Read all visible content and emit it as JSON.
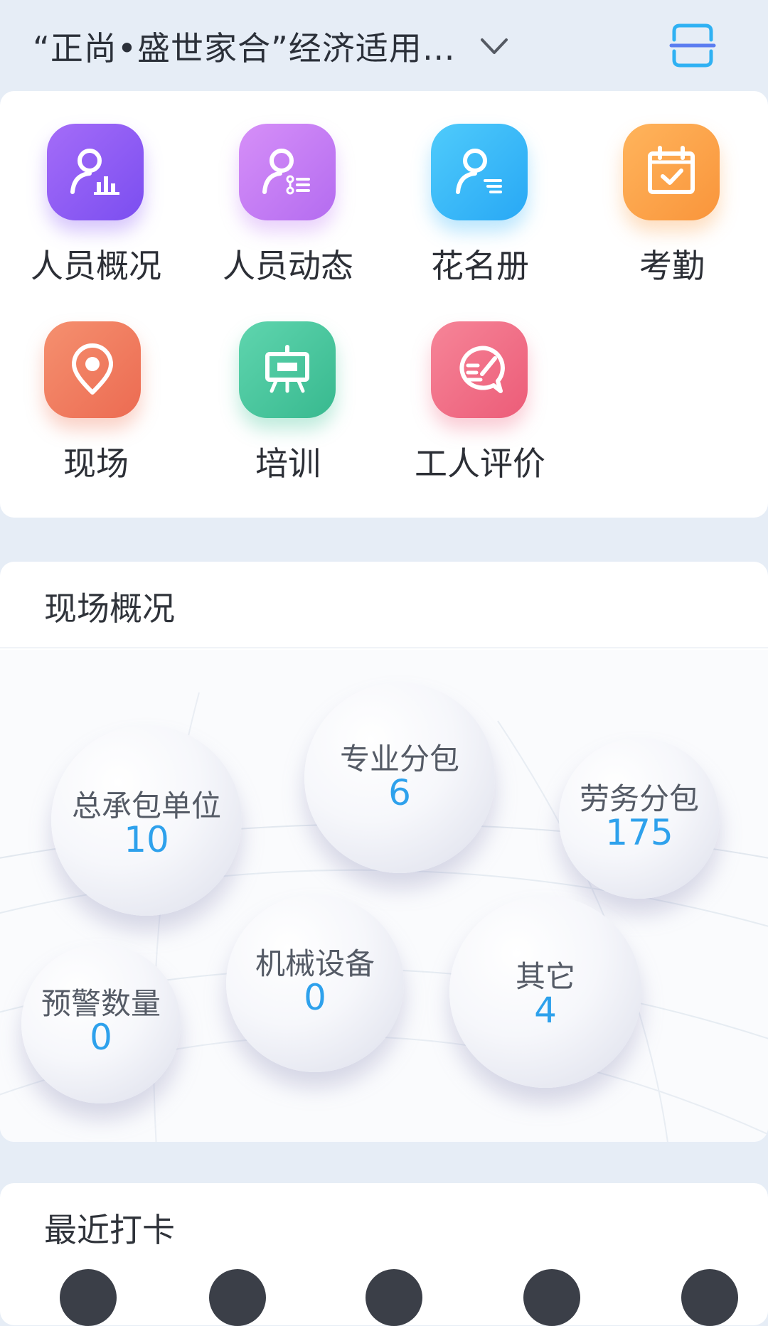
{
  "header": {
    "project_title": "“正尚•盛世家合”经济适用…"
  },
  "menu": {
    "items": [
      {
        "label": "人员概况",
        "icon": "personnel-overview-icon",
        "color": "#8b5cf6"
      },
      {
        "label": "人员动态",
        "icon": "personnel-dynamics-icon",
        "color": "#c07cf3"
      },
      {
        "label": "花名册",
        "icon": "roster-icon",
        "color": "#3bb8f8"
      },
      {
        "label": "考勤",
        "icon": "attendance-calendar-icon",
        "color": "#fca04b"
      },
      {
        "label": "现场",
        "icon": "location-pin-icon",
        "color": "#f07a5d"
      },
      {
        "label": "培训",
        "icon": "training-board-icon",
        "color": "#45c79c"
      },
      {
        "label": "工人评价",
        "icon": "evaluation-chat-icon",
        "color": "#f06d86"
      }
    ]
  },
  "site_overview": {
    "title": "现场概况",
    "bubbles": [
      {
        "label": "总承包单位",
        "value": "10"
      },
      {
        "label": "专业分包",
        "value": "6"
      },
      {
        "label": "劳务分包",
        "value": "175"
      },
      {
        "label": "预警数量",
        "value": "0"
      },
      {
        "label": "机械设备",
        "value": "0"
      },
      {
        "label": "其它",
        "value": "4"
      }
    ]
  },
  "recent_checkin": {
    "title": "最近打卡"
  }
}
